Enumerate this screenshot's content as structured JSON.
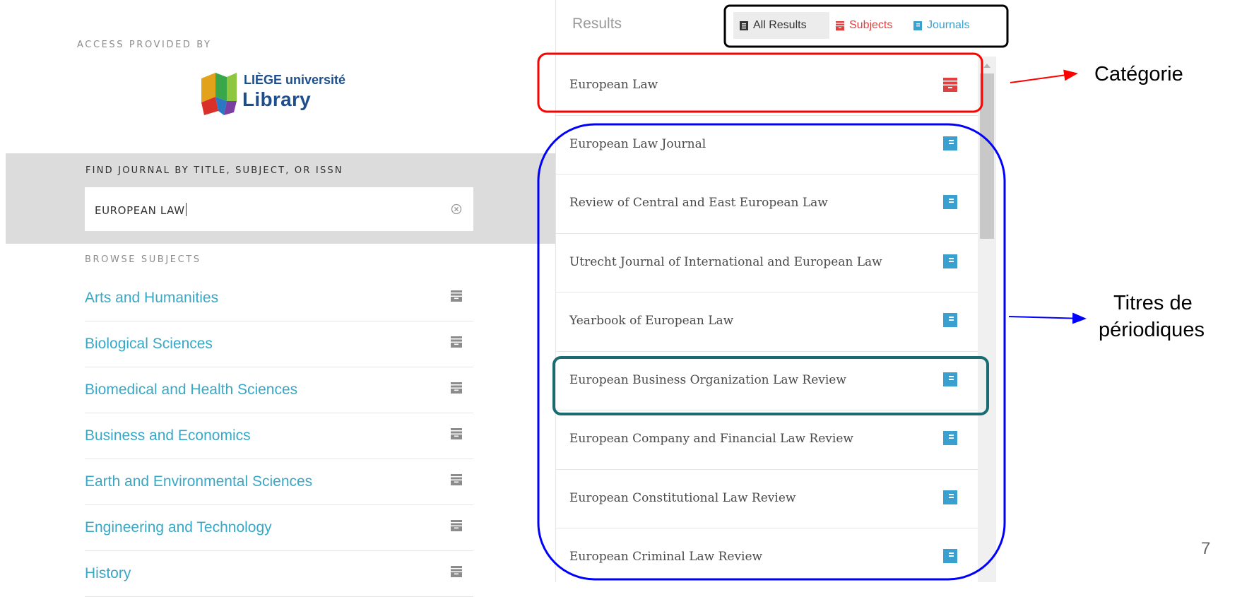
{
  "access_label": "ACCESS PROVIDED BY",
  "logo": {
    "line1": "LIÈGE université",
    "line2": "Library"
  },
  "search": {
    "label": "FIND JOURNAL BY TITLE, SUBJECT, OR ISSN",
    "value": "EUROPEAN LAW",
    "clear_icon": "clear-circle-icon"
  },
  "browse": {
    "label": "BROWSE SUBJECTS",
    "items": [
      {
        "label": "Arts and Humanities"
      },
      {
        "label": "Biological Sciences"
      },
      {
        "label": "Biomedical and Health Sciences"
      },
      {
        "label": "Business and Economics"
      },
      {
        "label": "Earth and Environmental Sciences"
      },
      {
        "label": "Engineering and Technology"
      },
      {
        "label": "History"
      }
    ],
    "icon": "archive-box-icon"
  },
  "results": {
    "title": "Results",
    "filters": [
      {
        "label": "All Results",
        "icon": "list-book-icon",
        "color": "#333333",
        "active": true
      },
      {
        "label": "Subjects",
        "icon": "archive-box-icon",
        "color": "#e2403f",
        "active": false
      },
      {
        "label": "Journals",
        "icon": "journal-book-icon",
        "color": "#3aa0d0",
        "active": false
      }
    ],
    "items": [
      {
        "label": "European Law",
        "kind": "subject"
      },
      {
        "label": "European Law Journal",
        "kind": "journal"
      },
      {
        "label": "Review of Central and East European Law",
        "kind": "journal"
      },
      {
        "label": "Utrecht Journal of International and European Law",
        "kind": "journal"
      },
      {
        "label": "Yearbook of European Law",
        "kind": "journal"
      },
      {
        "label": "European Business Organization Law Review",
        "kind": "journal"
      },
      {
        "label": "European Company and Financial Law Review",
        "kind": "journal"
      },
      {
        "label": "European Constitutional Law Review",
        "kind": "journal"
      },
      {
        "label": "European Criminal Law Review",
        "kind": "journal"
      }
    ]
  },
  "annotations": {
    "category": "Catégorie",
    "titles_line1": "Titres de",
    "titles_line2": "périodiques",
    "page_number": "7"
  },
  "colors": {
    "link": "#39a7c6",
    "subject_red": "#e2403f",
    "journal_blue": "#3aa0d0",
    "annotation_red": "#ff0000",
    "annotation_blue": "#0000ff",
    "annotation_teal": "#1b6b73",
    "annotation_black": "#000000"
  }
}
